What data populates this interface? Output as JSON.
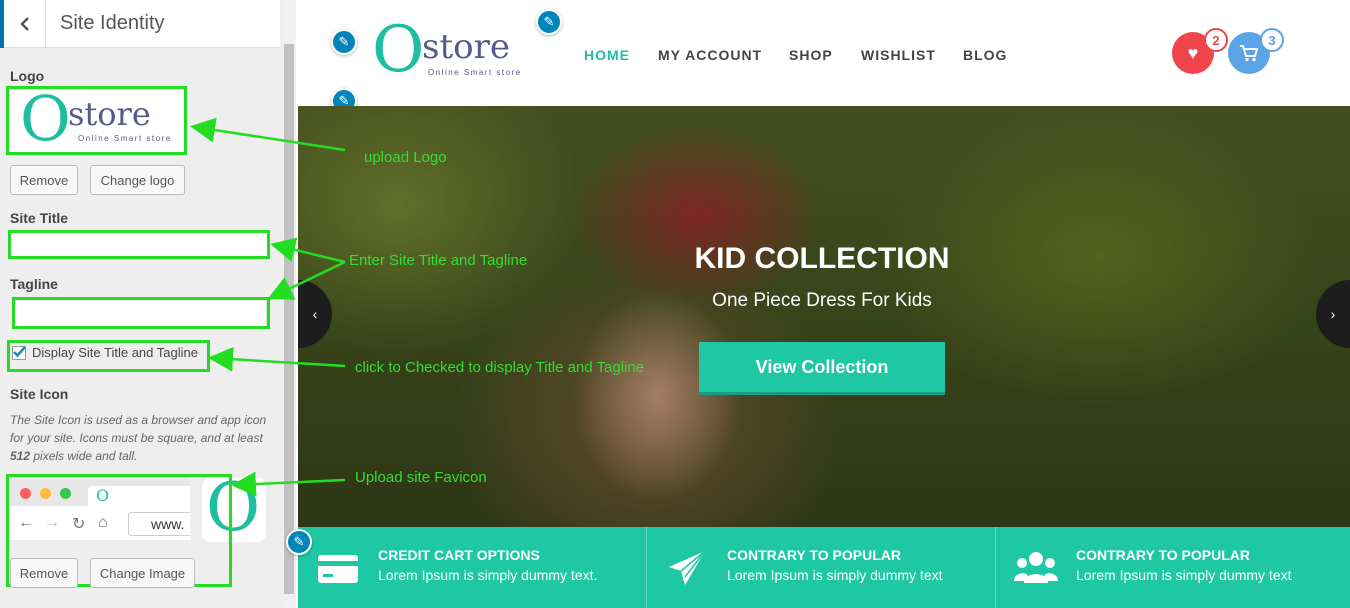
{
  "customizer": {
    "section_title": "Site Identity",
    "logo_label": "Logo",
    "logo_remove": "Remove",
    "logo_change": "Change logo",
    "site_title_label": "Site Title",
    "site_title_value": "",
    "tagline_label": "Tagline",
    "tagline_value": "",
    "display_title_tagline": "Display Site Title and Tagline",
    "site_icon_label": "Site Icon",
    "site_icon_desc_1": "The Site Icon is used as a browser and app icon for your site. Icons must be square, and at least ",
    "site_icon_desc_bold": "512",
    "site_icon_desc_2": " pixels wide and tall.",
    "icon_remove": "Remove",
    "icon_change": "Change Image",
    "favicon_url_preview": "www."
  },
  "annotations": {
    "upload_logo": "upload Logo",
    "enter_title": "Enter Site Title and Tagline",
    "click_checked": "click to Checked to display Title and Tagline",
    "upload_favicon": "Upload site Favicon"
  },
  "logo": {
    "letter": "O",
    "word": "store",
    "tagline": "Online Smart store"
  },
  "nav": [
    "HOME",
    "MY ACCOUNT",
    "SHOP",
    "WISHLIST",
    "BLOG"
  ],
  "wishlist_count": "2",
  "cart_count": "3",
  "hero": {
    "title": "KID COLLECTION",
    "subtitle": "One Piece Dress For Kids",
    "button": "View Collection"
  },
  "features": [
    {
      "title": "CREDIT CART OPTIONS",
      "text": "Lorem Ipsum is simply dummy text."
    },
    {
      "title": "CONTRARY TO POPULAR",
      "text": "Lorem Ipsum is simply dummy text"
    },
    {
      "title": "CONTRARY TO POPULAR",
      "text": "Lorem Ipsum is simply dummy text"
    }
  ],
  "colors": {
    "accent": "#1fc8a4",
    "annotation_green": "#22dd22",
    "wishlist_red": "#f0454b",
    "cart_blue": "#5ba4e6",
    "nav_active": "#1fbea0"
  }
}
